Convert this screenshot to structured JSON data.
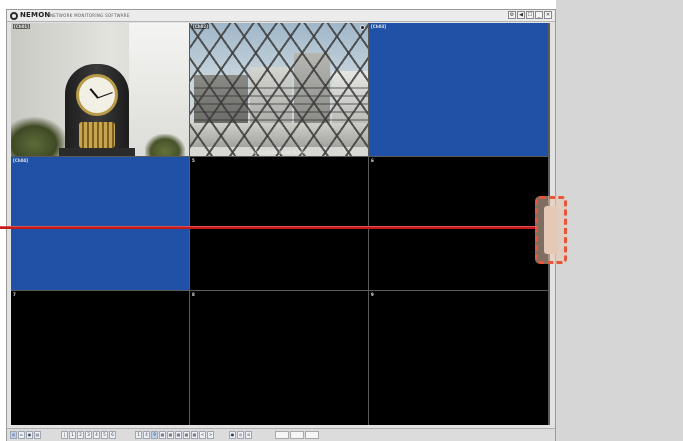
{
  "app": {
    "brand": "NEMON",
    "subtitle": "NETWORK MONITORING SOFTWARE",
    "window_controls": [
      "⚙",
      "◀",
      "☐",
      "_",
      "✕"
    ]
  },
  "cameras": [
    {
      "label": "[Ch01]",
      "feed": "clock"
    },
    {
      "label": "[Ch02]",
      "feed": "city",
      "timestamp": "2012/01/20 03:40:28 PM"
    },
    {
      "label": "[Ch03]",
      "feed": "blue"
    },
    {
      "label": "[Ch04]",
      "feed": "blue"
    },
    {
      "label": "5",
      "feed": "empty"
    },
    {
      "label": "6",
      "feed": "empty"
    },
    {
      "label": "7",
      "feed": "empty"
    },
    {
      "label": "8",
      "feed": "empty"
    },
    {
      "label": "9",
      "feed": "empty"
    }
  ],
  "toolbar": {
    "left_buttons": [
      "◎",
      "⌂",
      "▣",
      "▤"
    ],
    "page_buttons": [
      "|",
      "1",
      "2",
      "3",
      "4",
      "5",
      "6"
    ],
    "layout_buttons": [
      "1",
      "4",
      "9",
      "▦",
      "▦",
      "▦",
      "▦",
      "▦",
      "<",
      ">"
    ],
    "tool_buttons": [
      "●",
      "◎",
      "⊘"
    ],
    "right_buttons": [
      "",
      "",
      ""
    ]
  },
  "colors": {
    "idle_channel": "#1f52a7",
    "overlay_line": "#c41a1a",
    "overlay_handle_border": "#e5573b"
  }
}
